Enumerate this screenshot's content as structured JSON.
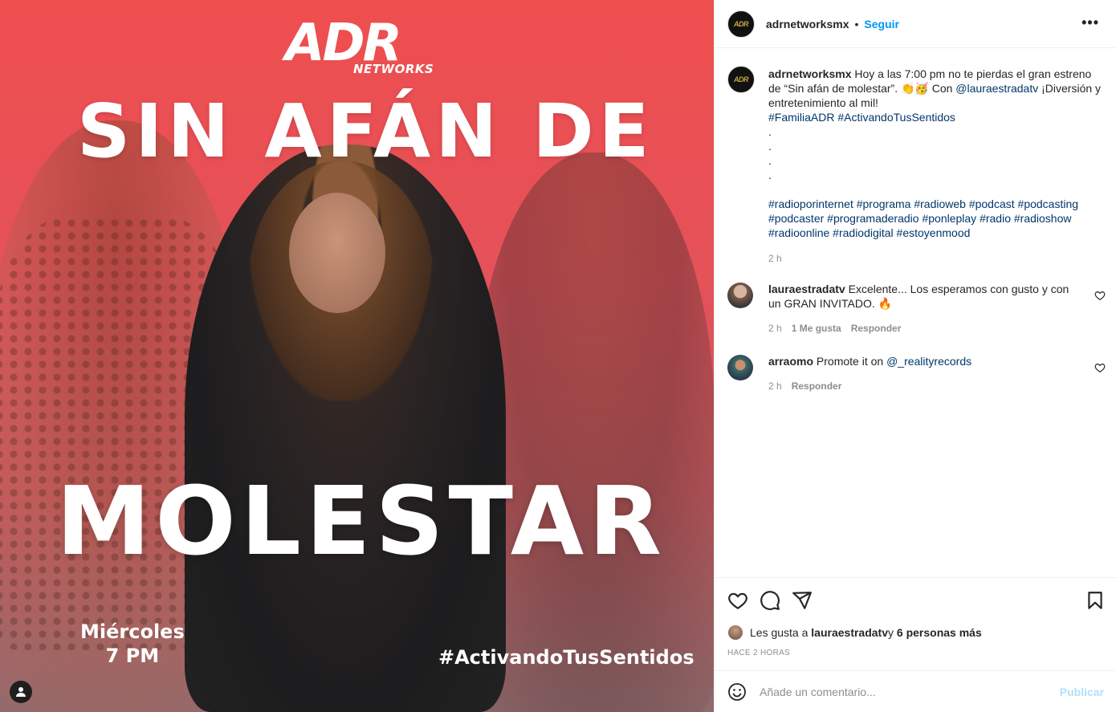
{
  "media": {
    "logo_main": "ADR",
    "logo_sub": "NETWORKS",
    "title_line1": "SIN AFÁN DE",
    "title_line2": "MOLESTAR",
    "day": "Miércoles",
    "time": "7 PM",
    "hashtag": "#ActivandoTusSentidos"
  },
  "header": {
    "avatar_text": "ADR",
    "username": "adrnetworksmx",
    "separator": "•",
    "follow_label": "Seguir",
    "more_label": "•••"
  },
  "post": {
    "username": "adrnetworksmx",
    "text_1": " Hoy a las 7:00 pm no te pierdas el gran estreno de “Sin afán de molestar”. 👏🥳 Con ",
    "mention": "@lauraestradatv",
    "text_2": " ¡Diversión y entretenimiento al mil!",
    "hashtags_1": "#FamiliaADR #ActivandoTusSentidos",
    "dots": [
      ".",
      ".",
      ".",
      "."
    ],
    "hashtags_2": "#radioporinternet #programa #radioweb #podcast #podcasting #podcaster #programaderadio #ponleplay #radio #radioshow #radioonline #radiodigital #estoyenmood",
    "time": "2 h"
  },
  "comments": [
    {
      "username": "lauraestradatv",
      "text": " Excelente... Los esperamos con gusto y con un GRAN INVITADO. 🔥",
      "time": "2 h",
      "likes": "1 Me gusta",
      "reply": "Responder"
    },
    {
      "username": "arraomo",
      "text": " Promote it on ",
      "mention": "@_realityrecords",
      "time": "2 h",
      "reply": "Responder"
    }
  ],
  "likes": {
    "prefix": "Les gusta a ",
    "user": "lauraestradatv",
    "middle": " y ",
    "others": "6 personas más"
  },
  "timestamp": "HACE 2 HORAS",
  "add_comment": {
    "placeholder": "Añade un comentario...",
    "publish_label": "Publicar"
  },
  "colors": {
    "accent": "#0095f6",
    "link": "#00376b",
    "muted": "#8e8e8e",
    "publish_disabled": "#b2dffc"
  }
}
